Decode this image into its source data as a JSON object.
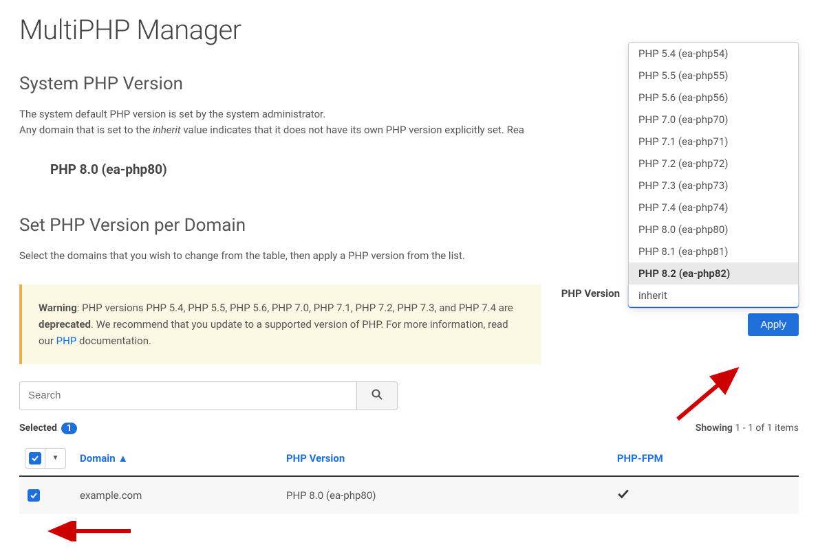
{
  "page": {
    "title": "MultiPHP Manager"
  },
  "system_version": {
    "heading": "System PHP Version",
    "desc1": "The system default PHP version is set by the system administrator.",
    "desc2_prefix": "Any domain that is set to the ",
    "desc2_italic": "inherit",
    "desc2_suffix": " value indicates that it does not have its own PHP version explicitly set. Rea",
    "current": "PHP 8.0 (ea-php80)"
  },
  "per_domain": {
    "heading": "Set PHP Version per Domain",
    "desc": "Select the domains that you wish to change from the table, then apply a PHP version from the list."
  },
  "warning": {
    "label": "Warning",
    "text1": ": PHP versions PHP 5.4, PHP 5.5, PHP 5.6, PHP 7.0, PHP 7.1, PHP 7.2, PHP 7.3, and PHP 7.4 are ",
    "deprecated": "deprecated",
    "text2": ". We recommend that you update to a supported version of PHP. For more information, read our ",
    "link": "PHP",
    "text3": " documentation."
  },
  "version_select": {
    "label": "PHP Version",
    "selected": "PHP 5.4 (ea-php54)",
    "apply": "Apply",
    "options": [
      "PHP 5.4 (ea-php54)",
      "PHP 5.5 (ea-php55)",
      "PHP 5.6 (ea-php56)",
      "PHP 7.0 (ea-php70)",
      "PHP 7.1 (ea-php71)",
      "PHP 7.2 (ea-php72)",
      "PHP 7.3 (ea-php73)",
      "PHP 7.4 (ea-php74)",
      "PHP 8.0 (ea-php80)",
      "PHP 8.1 (ea-php81)",
      "PHP 8.2 (ea-php82)",
      "inherit"
    ],
    "highlighted_index": 10
  },
  "search": {
    "placeholder": "Search"
  },
  "table": {
    "selected_label": "Selected",
    "selected_count": "1",
    "showing_label": "Showing",
    "showing_text": " 1 - 1 of 1 items",
    "columns": {
      "domain": "Domain",
      "sort_arrow": "▲",
      "php_version": "PHP Version",
      "php_fpm": "PHP-FPM"
    },
    "rows": [
      {
        "domain": "example.com",
        "version": "PHP 8.0 (ea-php80)",
        "fpm": true,
        "checked": true
      }
    ]
  }
}
